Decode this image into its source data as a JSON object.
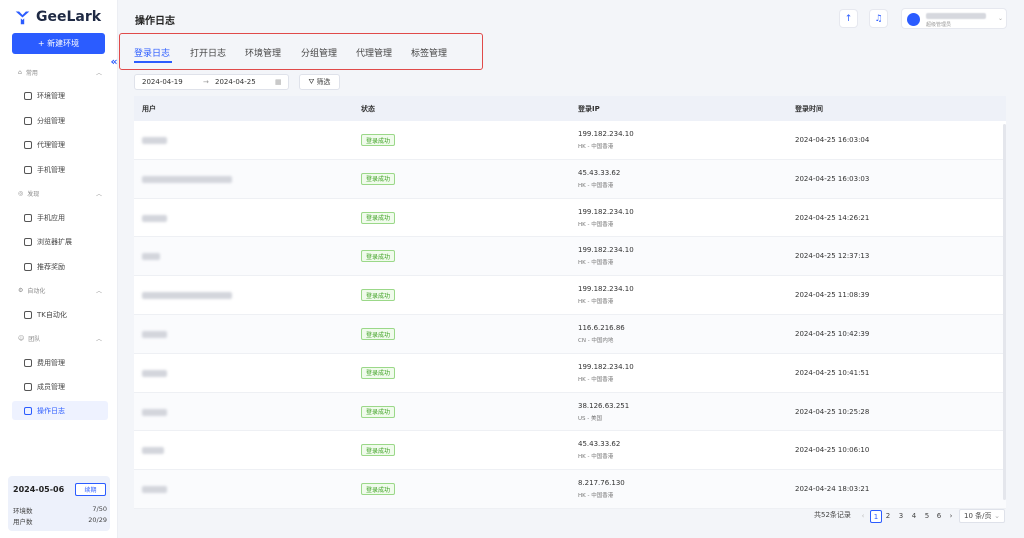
{
  "brand": {
    "name": "GeeLark",
    "accent": "#2b5cff"
  },
  "sidebar": {
    "new_env": "+ 新建环境",
    "groups": [
      {
        "label": "常用",
        "items": [
          "环境管理",
          "分组管理",
          "代理管理",
          "手机管理"
        ]
      },
      {
        "label": "发现",
        "items": [
          "手机应用",
          "浏览器扩展",
          "推荐奖励"
        ]
      },
      {
        "label": "自动化",
        "items": [
          "TK自动化"
        ]
      },
      {
        "label": "团队",
        "items": [
          "费用管理",
          "成员管理",
          "操作日志"
        ]
      }
    ],
    "footer": {
      "date": "2024-05-06",
      "renew": "续期",
      "env_label": "环境数",
      "env_value": "7/50",
      "user_label": "用户数",
      "user_value": "20/29"
    }
  },
  "header": {
    "title": "操作日志",
    "user_sub": "超级管理员"
  },
  "tabs": [
    "登录日志",
    "打开日志",
    "环境管理",
    "分组管理",
    "代理管理",
    "标签管理"
  ],
  "filter": {
    "start": "2024-04-19",
    "arrow": "→",
    "end": "2024-04-25",
    "button": "筛选"
  },
  "table": {
    "headers": [
      "用户",
      "状态",
      "登录IP",
      "登录时间"
    ],
    "rows": [
      {
        "status": "登录成功",
        "ip": "199.182.234.10",
        "region": "HK - 中国香港",
        "time": "2024-04-25 16:03:04"
      },
      {
        "status": "登录成功",
        "ip": "45.43.33.62",
        "region": "HK - 中国香港",
        "time": "2024-04-25 16:03:03"
      },
      {
        "status": "登录成功",
        "ip": "199.182.234.10",
        "region": "HK - 中国香港",
        "time": "2024-04-25 14:26:21"
      },
      {
        "status": "登录成功",
        "ip": "199.182.234.10",
        "region": "HK - 中国香港",
        "time": "2024-04-25 12:37:13"
      },
      {
        "status": "登录成功",
        "ip": "199.182.234.10",
        "region": "HK - 中国香港",
        "time": "2024-04-25 11:08:39"
      },
      {
        "status": "登录成功",
        "ip": "116.6.216.86",
        "region": "CN - 中国内地",
        "time": "2024-04-25 10:42:39"
      },
      {
        "status": "登录成功",
        "ip": "199.182.234.10",
        "region": "HK - 中国香港",
        "time": "2024-04-25 10:41:51"
      },
      {
        "status": "登录成功",
        "ip": "38.126.63.251",
        "region": "US - 美国",
        "time": "2024-04-25 10:25:28"
      },
      {
        "status": "登录成功",
        "ip": "45.43.33.62",
        "region": "HK - 中国香港",
        "time": "2024-04-25 10:06:10"
      },
      {
        "status": "登录成功",
        "ip": "8.217.76.130",
        "region": "HK - 中国香港",
        "time": "2024-04-24 18:03:21"
      }
    ]
  },
  "pagination": {
    "total": "共52条记录",
    "pages": [
      "1",
      "2",
      "3",
      "4",
      "5",
      "6"
    ],
    "prev": "‹",
    "next": "›",
    "per_page": "10 条/页"
  }
}
